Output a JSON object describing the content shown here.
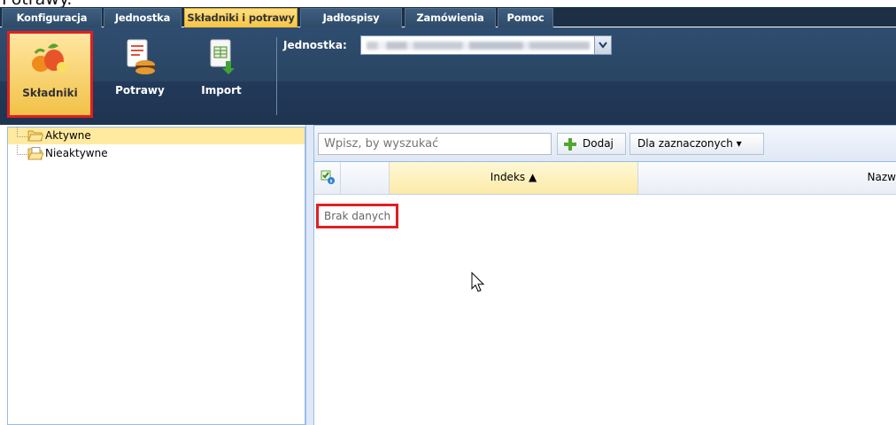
{
  "header_text": "Potrawy.",
  "tabs": [
    {
      "label": "Konfiguracja"
    },
    {
      "label": "Jednostka"
    },
    {
      "label": "Składniki i potrawy"
    },
    {
      "label": "Jadłospisy"
    },
    {
      "label": "Zamówienia"
    },
    {
      "label": "Pomoc"
    }
  ],
  "active_tab": "Składniki i potrawy",
  "ribbon": {
    "buttons": [
      {
        "label": "Składniki",
        "icon": "ingredients-icon"
      },
      {
        "label": "Potrawy",
        "icon": "dishes-icon"
      },
      {
        "label": "Import",
        "icon": "import-icon"
      }
    ],
    "unit_label": "Jednostka:"
  },
  "tree": {
    "items": [
      {
        "label": "Aktywne",
        "icon": "folder-open-icon",
        "selected": true
      },
      {
        "label": "Nieaktywne",
        "icon": "folder-icon",
        "selected": false
      }
    ]
  },
  "grid": {
    "search_placeholder": "Wpisz, by wyszukać",
    "add_label": "Dodaj",
    "bulk_label": "Dla zaznaczonych ▾",
    "columns": [
      {
        "label": "Indeks ▲"
      },
      {
        "label": "Nazw"
      }
    ],
    "empty_text": "Brak danych"
  },
  "colors": {
    "ribbon_bg": "#2a4563",
    "active_tab": "#f7c441",
    "selection_highlight": "#e02020"
  }
}
